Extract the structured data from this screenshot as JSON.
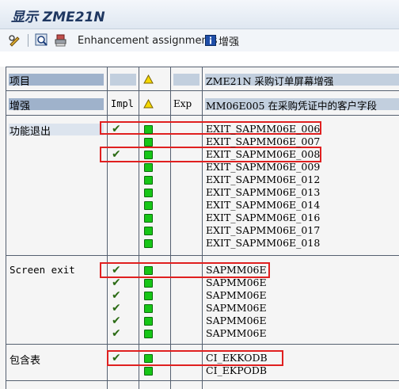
{
  "title": "显示 ZME21N",
  "toolbar": {
    "enhancement_label": "Enhancement assignments",
    "enh_btn_label": "增强"
  },
  "header": {
    "row1": {
      "label": "项目",
      "project_name": "ZME21N  采购订单屏幕增强"
    },
    "row2": {
      "label": "增强",
      "impl": "Impl",
      "exp": "Exp",
      "enhancement": "MM06E005 在采购凭证中的客户字段"
    }
  },
  "sections": {
    "function_exits": {
      "label": "功能退出",
      "items": [
        "EXIT_SAPMM06E_006",
        "EXIT_SAPMM06E_007",
        "EXIT_SAPMM06E_008",
        "EXIT_SAPMM06E_009",
        "EXIT_SAPMM06E_012",
        "EXIT_SAPMM06E_013",
        "EXIT_SAPMM06E_014",
        "EXIT_SAPMM06E_016",
        "EXIT_SAPMM06E_017",
        "EXIT_SAPMM06E_018"
      ]
    },
    "screen_exits": {
      "label": "Screen exit",
      "items": [
        "SAPMM06E",
        "SAPMM06E",
        "SAPMM06E",
        "SAPMM06E",
        "SAPMM06E",
        "SAPMM06E"
      ]
    },
    "includes": {
      "label": "包含表",
      "items": [
        "CI_EKKODB",
        "CI_EKPODB"
      ]
    }
  },
  "colors": {
    "highlight": "#e02020",
    "active": "#17c617",
    "check": "#2b6b14"
  }
}
